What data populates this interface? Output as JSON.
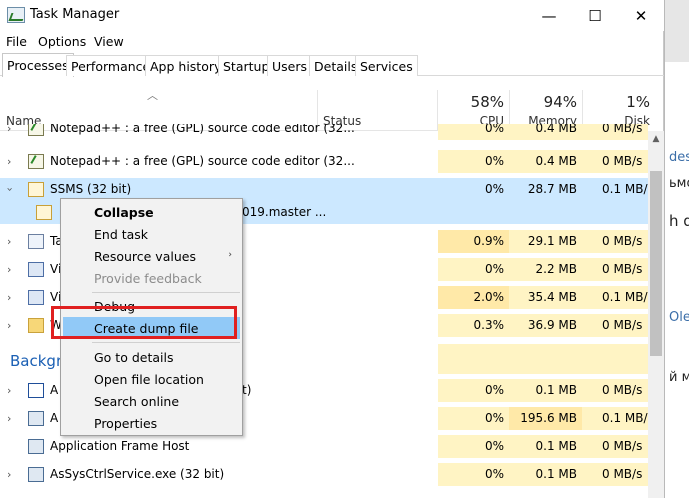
{
  "window": {
    "title": "Task Manager",
    "minimize_glyph": "—",
    "maximize_glyph": "☐",
    "close_glyph": "✕"
  },
  "menu": [
    "File",
    "Options",
    "View"
  ],
  "tabs": [
    "Processes",
    "Performance",
    "App history",
    "Startup",
    "Users",
    "Details",
    "Services"
  ],
  "columns": {
    "name": "Name",
    "status": "Status",
    "cpu": {
      "percent": "58%",
      "label": "CPU"
    },
    "memory": {
      "percent": "94%",
      "label": "Memory"
    },
    "disk": {
      "percent": "1%",
      "label": "Disk"
    }
  },
  "rows": [
    {
      "name": "Notepad++ : a free (GPL) source code editor (32...",
      "cpu": "0%",
      "memory": "0.4 MB",
      "disk": "0 MB/s",
      "icon": "notepad-icon"
    },
    {
      "name": "Notepad++ : a free (GPL) source code editor (32...",
      "cpu": "0%",
      "memory": "0.4 MB",
      "disk": "0 MB/s",
      "icon": "notepad-icon"
    },
    {
      "name": "SSMS (32 bit)",
      "cpu": "0%",
      "memory": "28.7 MB",
      "disk": "0.1 MB/s",
      "icon": "ssms-icon"
    },
    {
      "name": "019.master ...",
      "cpu": "",
      "memory": "",
      "disk": "",
      "icon": "ssms-icon"
    },
    {
      "name": "Ta",
      "cpu": "0.9%",
      "memory": "29.1 MB",
      "disk": "0 MB/s",
      "icon": "task-manager-icon"
    },
    {
      "name": "Vi",
      "cpu": "0%",
      "memory": "2.2 MB",
      "disk": "0 MB/s",
      "icon": "vm-icon"
    },
    {
      "name": "Vi",
      "cpu": "2.0%",
      "memory": "35.4 MB",
      "disk": "0.1 MB/s",
      "icon": "vm-icon"
    },
    {
      "name": "W",
      "cpu": "0.3%",
      "memory": "36.9 MB",
      "disk": "0 MB/s",
      "icon": "folder-icon"
    }
  ],
  "background_section": {
    "title": "Backgro",
    "rows": [
      {
        "name": "A",
        "suffix": "t)",
        "cpu": "0%",
        "memory": "0.1 MB",
        "disk": "0 MB/s",
        "icon": "app-icon"
      },
      {
        "name": "A",
        "suffix": "",
        "cpu": "0%",
        "memory": "195.6 MB",
        "disk": "0.1 MB/s",
        "icon": "service-icon"
      },
      {
        "name": "Application Frame Host",
        "suffix": "",
        "cpu": "0%",
        "memory": "0.1 MB",
        "disk": "0 MB/s",
        "icon": "service-icon"
      },
      {
        "name": "AsSysCtrlService.exe (32 bit)",
        "suffix": "",
        "cpu": "0%",
        "memory": "0.1 MB",
        "disk": "0 MB/s",
        "icon": "service-icon"
      }
    ]
  },
  "context_menu": {
    "items": [
      {
        "label": "Collapse",
        "bold": true
      },
      {
        "label": "End task"
      },
      {
        "label": "Resource values",
        "submenu": "›"
      },
      {
        "label": "Provide feedback",
        "disabled": true
      },
      {
        "label": "Debug"
      },
      {
        "label": "Create dump file",
        "highlighted": true
      },
      {
        "label": "Go to details"
      },
      {
        "label": "Open file location"
      },
      {
        "label": "Search online"
      },
      {
        "label": "Properties"
      }
    ]
  },
  "background_window_fragments": [
    "desk",
    "ьмо",
    "h d",
    "Oleo",
    "й м"
  ],
  "colors": {
    "selected_row": "#cce8ff",
    "heat_light": "#fff4c4",
    "heat_medium": "#ffe9a8",
    "menu_highlight": "#91c9f7",
    "annotation_red": "#e02020",
    "section_blue": "#1a5fb4"
  }
}
